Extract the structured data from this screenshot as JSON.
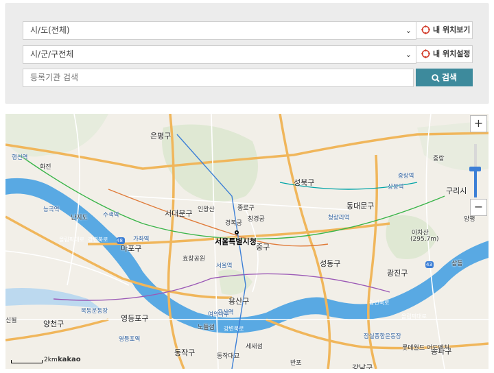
{
  "filters": {
    "province_select": "시/도(전체)",
    "district_select": "시/군/구전체",
    "my_location_view_label": "내 위치보기",
    "my_location_set_label": "내 위치설정",
    "search_placeholder": "등록기관 검색",
    "search_button_label": "검색"
  },
  "map": {
    "city_marker": "서울특별시청",
    "districts": [
      "은평구",
      "성북구",
      "서대문구",
      "종로구",
      "마포구",
      "중구",
      "용산구",
      "성동구",
      "광진구",
      "영등포구",
      "동작구",
      "강남구",
      "송파구",
      "양천구",
      "동대문구"
    ],
    "places": [
      "인왕산",
      "종로",
      "경복궁",
      "창경궁",
      "아차산",
      "(295.7m)",
      "구리시",
      "청량리역",
      "상봉역",
      "중랑역",
      "가좌역",
      "서울역",
      "수색역",
      "난지도",
      "행신역",
      "화전",
      "능곡역",
      "노들섬",
      "여의나루",
      "영등포역",
      "목동운동장",
      "잠실종합운동장",
      "롯데월드 어드벤처",
      "신월",
      "동작대교",
      "세새섬",
      "반포",
      "상동",
      "양평",
      "용산역",
      "효창공원",
      "중랑"
    ],
    "road_numbers": [
      "48",
      "43"
    ],
    "river_labels": [
      "강변북로",
      "올림픽대로",
      "강변북로",
      "강변북로",
      "올림픽대로"
    ],
    "scale_label": "2km",
    "brand": "kakao",
    "zoom_in": "+",
    "zoom_out": "−",
    "zoom_level_fraction": 0.5
  },
  "colors": {
    "river": "#59a9e3",
    "search_button": "#3d8a9c",
    "zoom_accent": "#3c7fd6"
  }
}
